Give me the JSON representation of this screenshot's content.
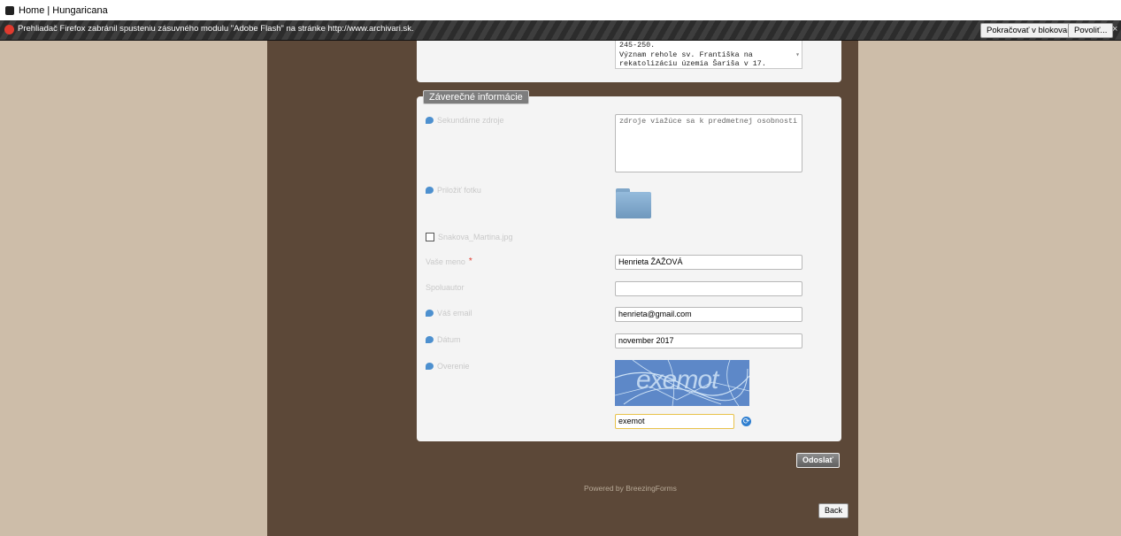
{
  "browser": {
    "tab_title": "Home | Hungaricana",
    "tab_icon": "page-icon"
  },
  "notification": {
    "text": "Prehliadač Firefox zabránil spusteniu zásuvného modulu \"Adobe Flash\" na stránke http://www.archivari.sk.",
    "continue_label": "Pokračovať v blokovaní",
    "allow_label": "Povoliť...",
    "close_label": "×"
  },
  "top_textarea": {
    "text": "245-250.\nVýznam rehole sv. Františka na\nrekatolizáciu územia Šariša v 17."
  },
  "section": {
    "legend": "Záverečné informácie"
  },
  "fields": {
    "secondary_sources": {
      "label": "Sekundárne zdroje",
      "value": "zdroje viažúce sa k predmetnej osobnosti"
    },
    "attach_photo": {
      "label": "Priložiť fotku"
    },
    "attached_file": {
      "label": "Snakova_Martina.jpg"
    },
    "name": {
      "label": "Vaše meno",
      "required_mark": "*",
      "value": "Henrieta ŽAŽOVÁ"
    },
    "coauthor": {
      "label": "Spoluautor",
      "value": ""
    },
    "email": {
      "label": "Váš email",
      "value": "henrieta@gmail.com"
    },
    "date": {
      "label": "Dátum",
      "value": "november 2017"
    },
    "verification": {
      "label": "Overenie",
      "captcha_text": "exemot",
      "value": "exemot"
    }
  },
  "actions": {
    "submit_label": "Odoslať",
    "back_label": "Back"
  },
  "footer": {
    "powered": "Powered by BreezingForms"
  },
  "colors": {
    "page_bg": "#cdbda9",
    "column_bg": "#5c4838",
    "panel_bg": "#f4f4f4",
    "hint_icon": "#4d90cf",
    "required": "#e03a2e"
  }
}
